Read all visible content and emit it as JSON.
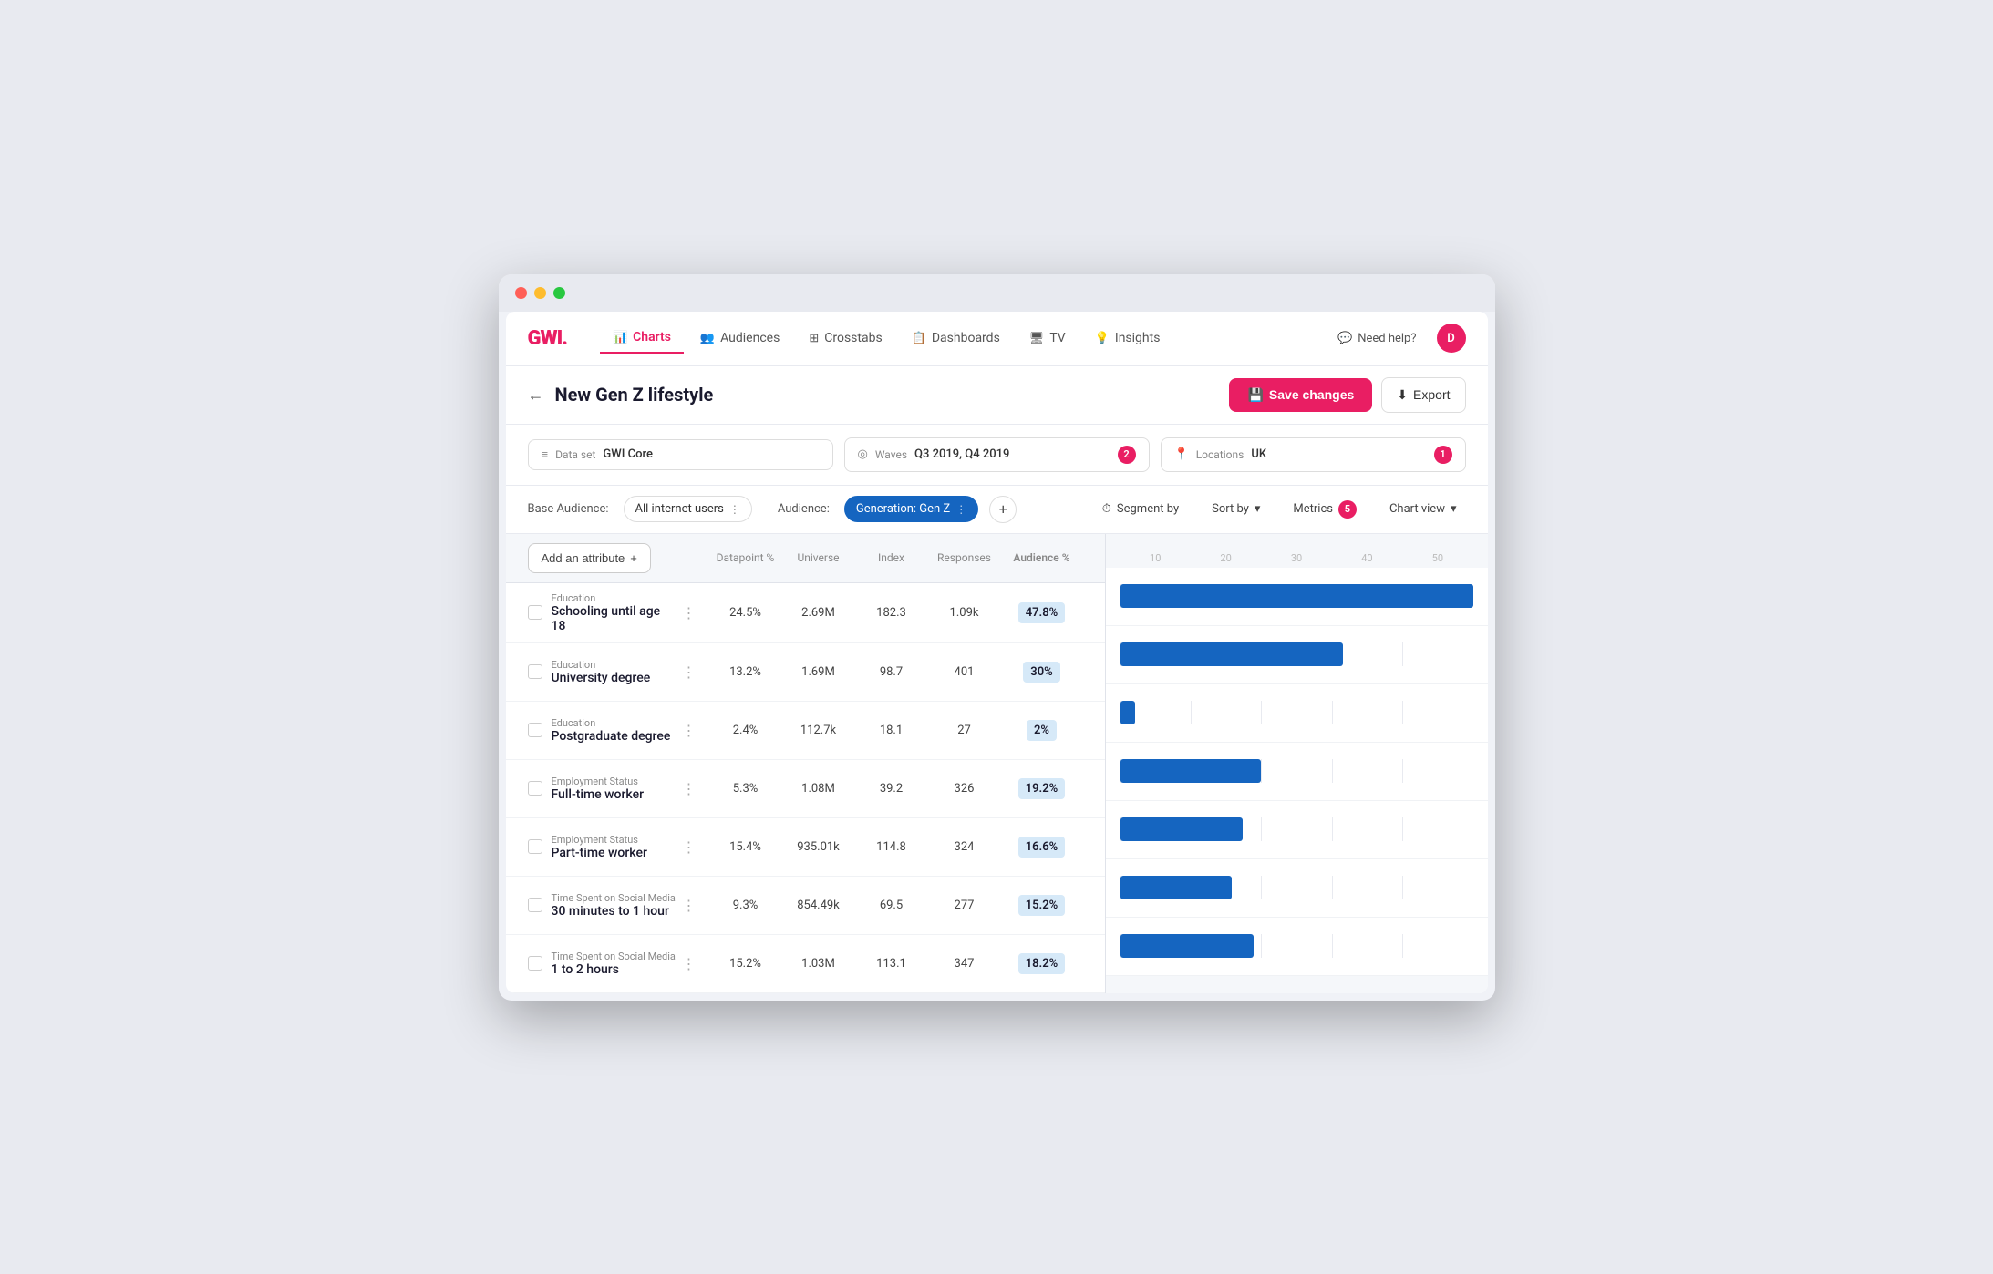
{
  "window": {
    "titlebar": {
      "dots": [
        "red",
        "yellow",
        "green"
      ]
    }
  },
  "navbar": {
    "logo": "GWI",
    "logo_dot": ".",
    "items": [
      {
        "label": "Charts",
        "icon": "📊",
        "active": true
      },
      {
        "label": "Audiences",
        "icon": "👥",
        "active": false
      },
      {
        "label": "Crosstabs",
        "icon": "⊞",
        "active": false
      },
      {
        "label": "Dashboards",
        "icon": "📋",
        "active": false
      },
      {
        "label": "TV",
        "icon": "🖥",
        "active": false
      },
      {
        "label": "Insights",
        "icon": "💡",
        "active": false
      }
    ],
    "need_help": "Need help?",
    "user_initial": "D"
  },
  "toolbar": {
    "back_label": "←",
    "title": "New Gen Z lifestyle",
    "save_label": "Save changes",
    "export_label": "Export"
  },
  "filters": {
    "dataset_label": "Data set",
    "dataset_value": "GWI Core",
    "waves_label": "Waves",
    "waves_value": "Q3 2019, Q4 2019",
    "waves_badge": "2",
    "locations_label": "Locations",
    "locations_value": "UK",
    "locations_badge": "1"
  },
  "audience": {
    "base_label": "Base Audience:",
    "audience_label": "Audience:",
    "base_chip": "All internet users",
    "audience_chip": "Generation: Gen Z",
    "segment_by": "Segment by",
    "sort_by": "Sort by",
    "metrics_label": "Metrics",
    "metrics_count": "5",
    "chart_view": "Chart view"
  },
  "table": {
    "add_attribute": "Add an attribute",
    "headers": [
      "Datapoint %",
      "Universe",
      "Index",
      "Responses",
      "Audience %"
    ],
    "axis_labels": [
      "10",
      "20",
      "30",
      "40",
      "50"
    ],
    "rows": [
      {
        "category": "Education",
        "name": "Schooling until age 18",
        "datapoint": "24.5%",
        "universe": "2.69M",
        "index": "182.3",
        "responses": "1.09k",
        "audience": "47.8%",
        "bar_pct": 95,
        "bar_light_pct": 0
      },
      {
        "category": "Education",
        "name": "University degree",
        "datapoint": "13.2%",
        "universe": "1.69M",
        "index": "98.7",
        "responses": "401",
        "audience": "30%",
        "bar_pct": 60,
        "bar_light_pct": 0
      },
      {
        "category": "Education",
        "name": "Postgraduate degree",
        "datapoint": "2.4%",
        "universe": "112.7k",
        "index": "18.1",
        "responses": "27",
        "audience": "2%",
        "bar_pct": 4,
        "bar_light_pct": 0
      },
      {
        "category": "Employment Status",
        "name": "Full-time worker",
        "datapoint": "5.3%",
        "universe": "1.08M",
        "index": "39.2",
        "responses": "326",
        "audience": "19.2%",
        "bar_pct": 38,
        "bar_light_pct": 0
      },
      {
        "category": "Employment Status",
        "name": "Part-time worker",
        "datapoint": "15.4%",
        "universe": "935.01k",
        "index": "114.8",
        "responses": "324",
        "audience": "16.6%",
        "bar_pct": 33,
        "bar_light_pct": 0
      },
      {
        "category": "Time Spent on Social Media",
        "name": "30 minutes to 1 hour",
        "datapoint": "9.3%",
        "universe": "854.49k",
        "index": "69.5",
        "responses": "277",
        "audience": "15.2%",
        "bar_pct": 30,
        "bar_light_pct": 0
      },
      {
        "category": "Time Spent on Social Media",
        "name": "1 to 2 hours",
        "datapoint": "15.2%",
        "universe": "1.03M",
        "index": "113.1",
        "responses": "347",
        "audience": "18.2%",
        "bar_pct": 36,
        "bar_light_pct": 0
      }
    ]
  }
}
